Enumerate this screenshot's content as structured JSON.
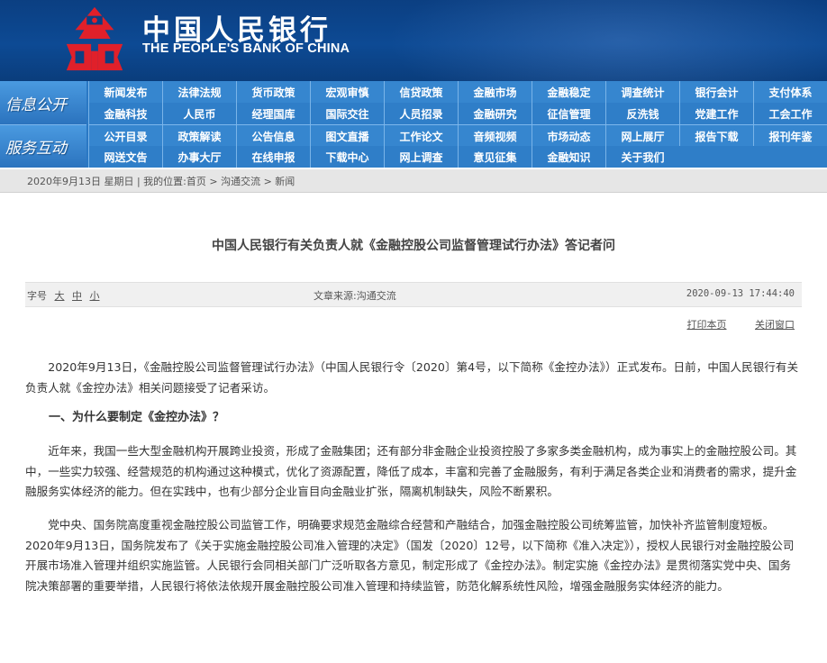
{
  "header": {
    "title_cn": "中国人民银行",
    "title_en": "THE PEOPLE'S BANK OF CHINA",
    "logo_icon": "pboc-logo-icon",
    "colors": {
      "banner": "#0b3f82",
      "nav": "#2a78c4",
      "logo_red": "#e0202a"
    }
  },
  "nav": {
    "section1_label": "信息公开",
    "section2_label": "服务互动",
    "rows": [
      [
        "新闻发布",
        "法律法规",
        "货币政策",
        "宏观审慎",
        "信贷政策",
        "金融市场",
        "金融稳定",
        "调查统计",
        "银行会计",
        "支付体系"
      ],
      [
        "金融科技",
        "人民币",
        "经理国库",
        "国际交往",
        "人员招录",
        "金融研究",
        "征信管理",
        "反洗钱",
        "党建工作",
        "工会工作"
      ],
      [
        "公开目录",
        "政策解读",
        "公告信息",
        "图文直播",
        "工作论文",
        "音频视频",
        "市场动态",
        "网上展厅",
        "报告下载",
        "报刊年鉴"
      ],
      [
        "网送文告",
        "办事大厅",
        "在线申报",
        "下载中心",
        "网上调查",
        "意见征集",
        "金融知识",
        "关于我们",
        "",
        ""
      ]
    ]
  },
  "breadcrumb": {
    "text": "2020年9月13日 星期日 | 我的位置:首页 > 沟通交流 > 新闻"
  },
  "article": {
    "title": "中国人民银行有关负责人就《金融控股公司监督管理试行办法》答记者问",
    "font_size_label": "字号",
    "font_size_options": [
      "大",
      "中",
      "小"
    ],
    "source": "文章来源:沟通交流",
    "date": "2020-09-13 17:44:40",
    "print_label": "打印本页",
    "close_label": "关闭窗口",
    "para1": "2020年9月13日，《金融控股公司监督管理试行办法》（中国人民银行令〔2020〕第4号，以下简称《金控办法》）正式发布。日前，中国人民银行有关负责人就《金控办法》相关问题接受了记者采访。",
    "heading1": "一、为什么要制定《金控办法》？",
    "para2": "近年来，我国一些大型金融机构开展跨业投资，形成了金融集团；还有部分非金融企业投资控股了多家多类金融机构，成为事实上的金融控股公司。其中，一些实力较强、经营规范的机构通过这种模式，优化了资源配置，降低了成本，丰富和完善了金融服务，有利于满足各类企业和消费者的需求，提升金融服务实体经济的能力。但在实践中，也有少部分企业盲目向金融业扩张，隔离机制缺失，风险不断累积。",
    "para3": "党中央、国务院高度重视金融控股公司监管工作，明确要求规范金融综合经营和产融结合，加强金融控股公司统筹监管，加快补齐监管制度短板。2020年9月13日，国务院发布了《关于实施金融控股公司准入管理的决定》（国发〔2020〕12号，以下简称《准入决定》），授权人民银行对金融控股公司开展市场准入管理并组织实施监管。人民银行会同相关部门广泛听取各方意见，制定形成了《金控办法》。制定实施《金控办法》是贯彻落实党中央、国务院决策部署的重要举措，人民银行将依法依规开展金融控股公司准入管理和持续监管，防范化解系统性风险，增强金融服务实体经济的能力。"
  }
}
